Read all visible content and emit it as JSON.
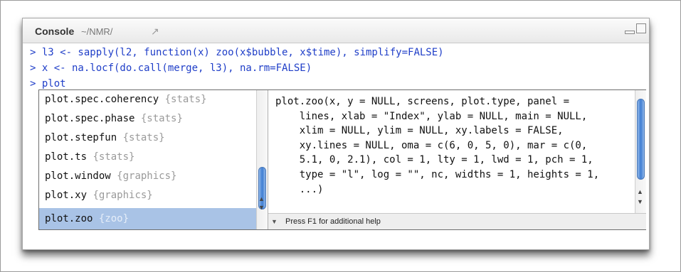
{
  "console": {
    "title": "Console",
    "path": "~/NMR/",
    "nav_icon": "↗",
    "lines": [
      "> l3 <- sapply(l2, function(x) zoo(x$bubble, x$time), simplify=FALSE)",
      "> x <- na.locf(do.call(merge, l3), na.rm=FALSE)",
      "> plot"
    ]
  },
  "completion": {
    "items": [
      {
        "name": "plot.spec.coherency",
        "pkg": "{stats}"
      },
      {
        "name": "plot.spec.phase",
        "pkg": "{stats}"
      },
      {
        "name": "plot.stepfun",
        "pkg": "{stats}"
      },
      {
        "name": "plot.ts",
        "pkg": "{stats}"
      },
      {
        "name": "plot.window",
        "pkg": "{graphics}"
      },
      {
        "name": "plot.xy",
        "pkg": "{graphics}"
      },
      {
        "name": "plot.zoo",
        "pkg": "{zoo}"
      }
    ],
    "selected_index": 6,
    "help_text": "plot.zoo(x, y = NULL, screens, plot.type, panel =\n    lines, xlab = \"Index\", ylab = NULL, main = NULL,\n    xlim = NULL, ylim = NULL, xy.labels = FALSE,\n    xy.lines = NULL, oma = c(6, 0, 5, 0), mar = c(0,\n    5.1, 0, 2.1), col = 1, lty = 1, lwd = 1, pch = 1,\n    type = \"l\", log = \"\", nc, widths = 1, heights = 1,\n    ...)",
    "footer_text": "Press F1 for additional help"
  },
  "colors": {
    "input_text": "#1f3ec8",
    "selection": "#a9c3e6",
    "package_text": "#9a9a9a",
    "scroll_thumb": "#3f7ed3"
  }
}
